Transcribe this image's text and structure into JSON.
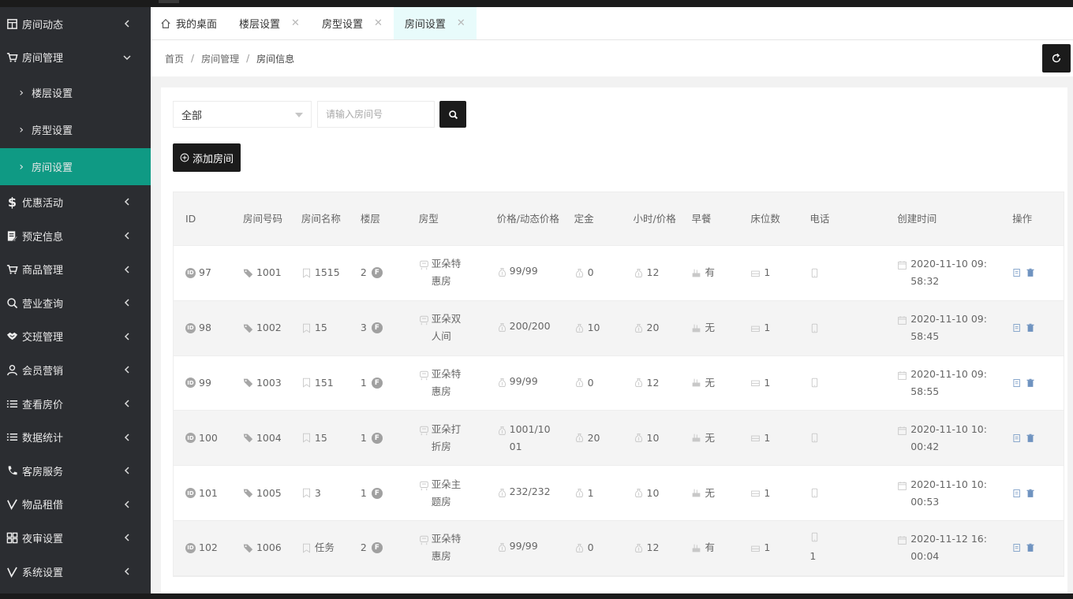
{
  "sidebar": {
    "items": [
      {
        "label": "房间动态",
        "icon": "building-icon",
        "expanded": false
      },
      {
        "label": "房间管理",
        "icon": "cart-icon",
        "expanded": true
      },
      {
        "label": "优惠活动",
        "icon": "dollar-icon",
        "expanded": false
      },
      {
        "label": "预定信息",
        "icon": "edit-note-icon",
        "expanded": false
      },
      {
        "label": "商品管理",
        "icon": "cart-icon",
        "expanded": false
      },
      {
        "label": "营业查询",
        "icon": "search-icon",
        "expanded": false
      },
      {
        "label": "交班管理",
        "icon": "handshake-icon",
        "expanded": false
      },
      {
        "label": "会员营销",
        "icon": "user-icon",
        "expanded": false
      },
      {
        "label": "查看房价",
        "icon": "list-icon",
        "expanded": false
      },
      {
        "label": "数据统计",
        "icon": "list-icon",
        "expanded": false
      },
      {
        "label": "客房服务",
        "icon": "phone-icon",
        "expanded": false
      },
      {
        "label": "物品租借",
        "icon": "check-icon",
        "expanded": false
      },
      {
        "label": "夜审设置",
        "icon": "grid-icon",
        "expanded": false
      },
      {
        "label": "系统设置",
        "icon": "check-icon",
        "expanded": false
      }
    ],
    "sub_items": [
      {
        "label": "楼层设置",
        "active": false
      },
      {
        "label": "房型设置",
        "active": false
      },
      {
        "label": "房间设置",
        "active": true
      }
    ],
    "active_color": "#0f9a84"
  },
  "tabs": [
    {
      "label": "我的桌面",
      "closable": false,
      "active": false
    },
    {
      "label": "楼层设置",
      "closable": true,
      "active": false
    },
    {
      "label": "房型设置",
      "closable": true,
      "active": false
    },
    {
      "label": "房间设置",
      "closable": true,
      "active": true
    }
  ],
  "breadcrumb": [
    "首页",
    "房间管理",
    "房间信息"
  ],
  "filter": {
    "select_value": "全部",
    "search_placeholder": "请输入房间号"
  },
  "add_button_label": "添加房间",
  "table": {
    "headers": [
      "ID",
      "房间号码",
      "房间名称",
      "楼层",
      "房型",
      "价格/动态价格",
      "定金",
      "小时/价格",
      "早餐",
      "床位数",
      "电话",
      "创建时间",
      "操作"
    ],
    "rows": [
      {
        "id": "97",
        "number": "1001",
        "name": "1515",
        "floor": "2",
        "type": "亚朵特惠房",
        "price": "99/99",
        "deposit": "0",
        "hourly": "12",
        "breakfast": "有",
        "beds": "1",
        "phone": "",
        "created": "2020-11-10 09:58:32"
      },
      {
        "id": "98",
        "number": "1002",
        "name": "15",
        "floor": "3",
        "type": "亚朵双人间",
        "price": "200/200",
        "deposit": "10",
        "hourly": "20",
        "breakfast": "无",
        "beds": "1",
        "phone": "",
        "created": "2020-11-10 09:58:45"
      },
      {
        "id": "99",
        "number": "1003",
        "name": "151",
        "floor": "1",
        "type": "亚朵特惠房",
        "price": "99/99",
        "deposit": "0",
        "hourly": "12",
        "breakfast": "无",
        "beds": "1",
        "phone": "",
        "created": "2020-11-10 09:58:55"
      },
      {
        "id": "100",
        "number": "1004",
        "name": "15",
        "floor": "1",
        "type": "亚朵打折房",
        "price": "1001/1001",
        "deposit": "20",
        "hourly": "10",
        "breakfast": "无",
        "beds": "1",
        "phone": "",
        "created": "2020-11-10 10:00:42"
      },
      {
        "id": "101",
        "number": "1005",
        "name": "3",
        "floor": "1",
        "type": "亚朵主题房",
        "price": "232/232",
        "deposit": "1",
        "hourly": "10",
        "breakfast": "无",
        "beds": "1",
        "phone": "",
        "created": "2020-11-10 10:00:53"
      },
      {
        "id": "102",
        "number": "1006",
        "name": "任务",
        "floor": "2",
        "type": "亚朵特惠房",
        "price": "99/99",
        "deposit": "0",
        "hourly": "12",
        "breakfast": "有",
        "beds": "1",
        "phone": "1",
        "created": "2020-11-12 16:00:04"
      }
    ]
  }
}
